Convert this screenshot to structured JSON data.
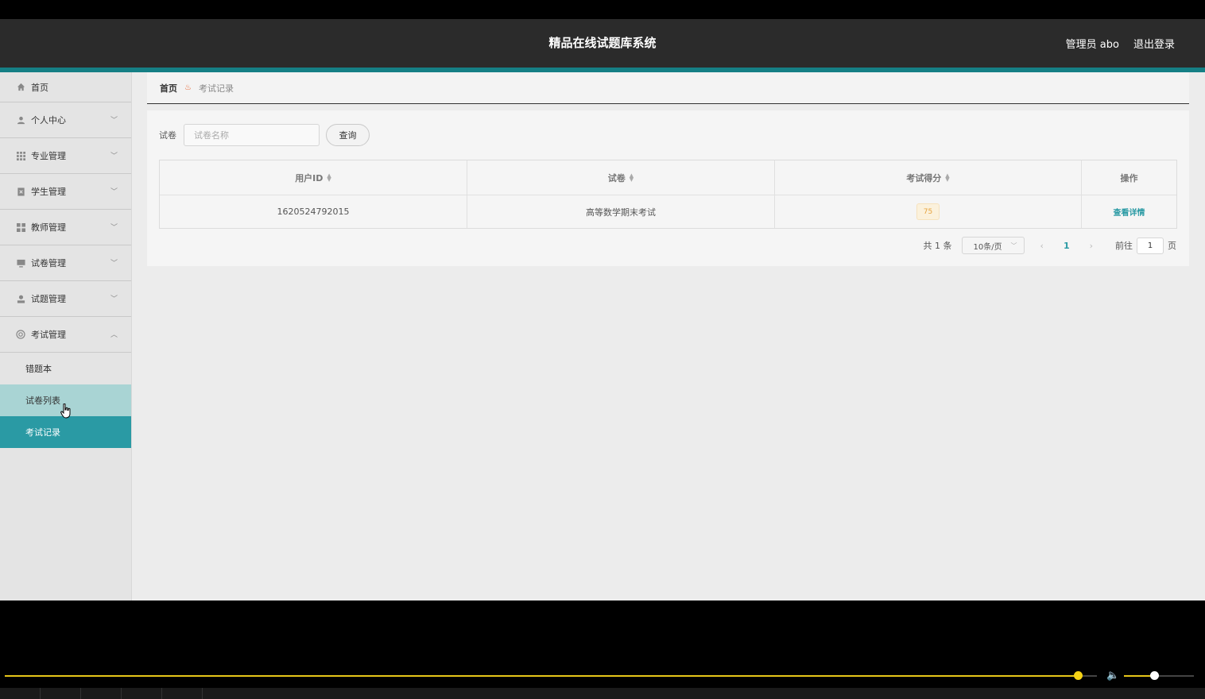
{
  "header": {
    "title": "精品在线试题库系统",
    "user_label": "管理员 abo",
    "logout_label": "退出登录"
  },
  "sidebar": {
    "items": [
      {
        "label": "首页",
        "icon": "home-icon"
      },
      {
        "label": "个人中心",
        "icon": "user-icon"
      },
      {
        "label": "专业管理",
        "icon": "grid-icon"
      },
      {
        "label": "学生管理",
        "icon": "student-icon"
      },
      {
        "label": "教师管理",
        "icon": "apps-icon"
      },
      {
        "label": "试卷管理",
        "icon": "monitor-icon"
      },
      {
        "label": "试题管理",
        "icon": "person-icon"
      },
      {
        "label": "考试管理",
        "icon": "circle-icon"
      }
    ],
    "sub_items": [
      {
        "label": "错题本"
      },
      {
        "label": "试卷列表"
      },
      {
        "label": "考试记录"
      }
    ]
  },
  "breadcrumb": {
    "home": "首页",
    "current": "考试记录"
  },
  "search": {
    "label": "试卷",
    "placeholder": "试卷名称",
    "button": "查询"
  },
  "table": {
    "headers": [
      "用户ID",
      "试卷",
      "考试得分",
      "操作"
    ],
    "rows": [
      {
        "user_id": "1620524792015",
        "paper": "高等数学期末考试",
        "score": "75",
        "action": "查看详情"
      }
    ]
  },
  "pager": {
    "total": "共 1 条",
    "page_size": "10条/页",
    "current_page": "1",
    "goto_prefix": "前往",
    "goto_value": "1",
    "goto_suffix": "页"
  },
  "player": {
    "progress": 0.98,
    "volume": 0.4
  },
  "colors": {
    "accent": "#2a9aa4",
    "topbar": "#2b2b2b",
    "topbar_accent": "#157f85",
    "progress": "#e6c619"
  }
}
